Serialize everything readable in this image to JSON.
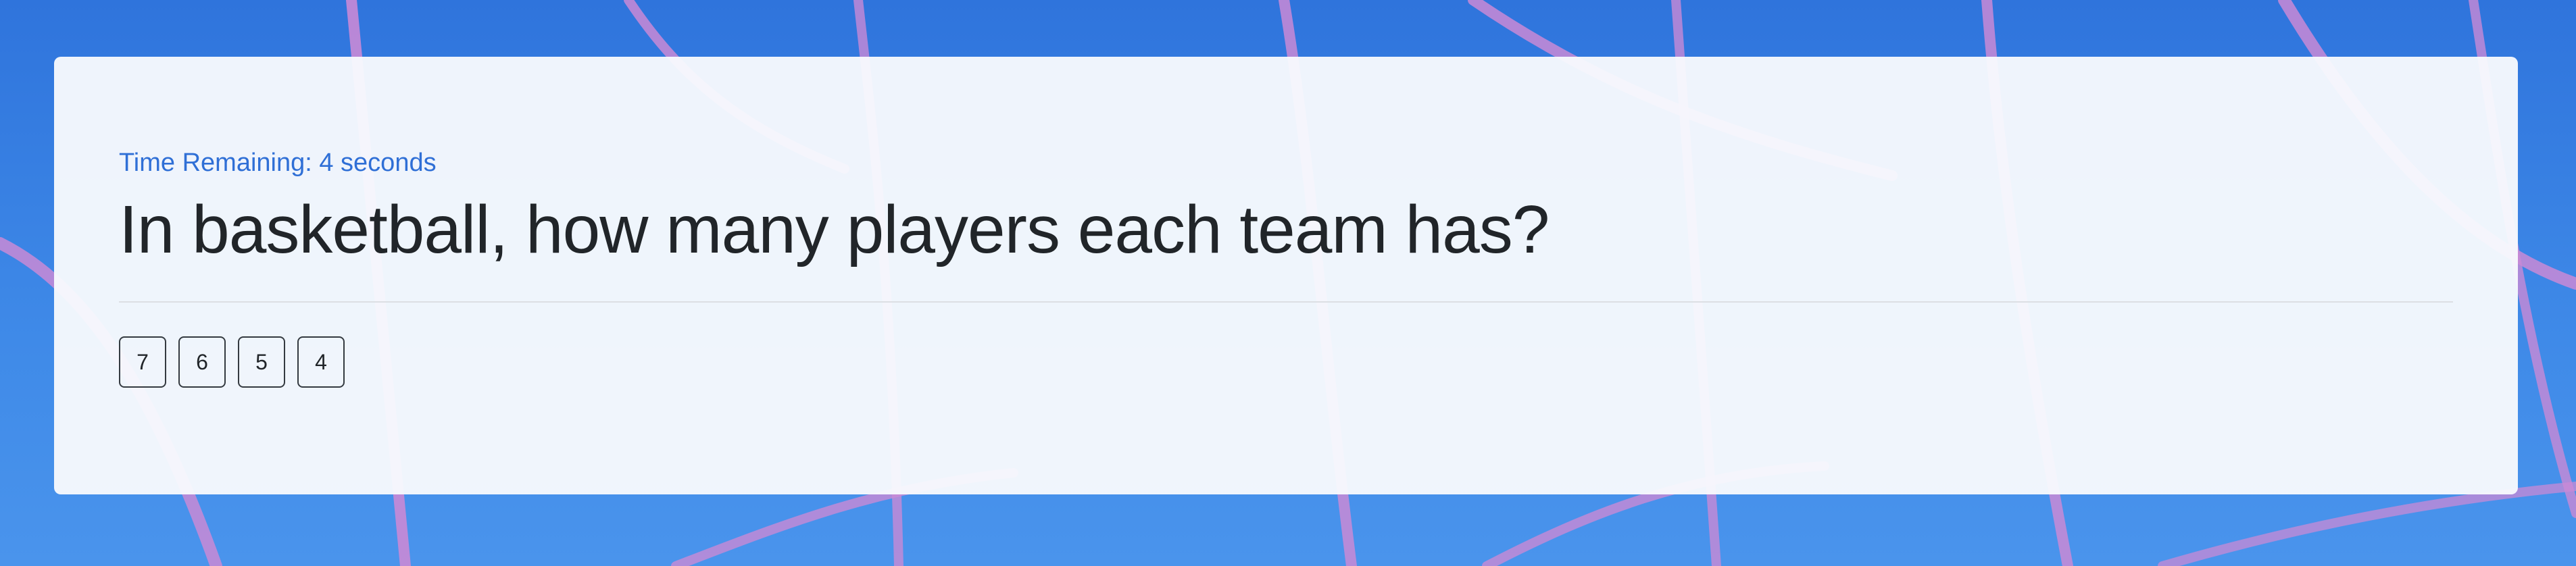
{
  "theme": {
    "background_blue": "#3a82e4",
    "net_color": "#c98ad6",
    "card_background": "#f8fafd",
    "timer_color": "#2f6fd6",
    "text_color": "#212529"
  },
  "quiz": {
    "timer_text": "Time Remaining: 4 seconds",
    "question": "In basketball, how many players each team has?",
    "answers": [
      "7",
      "6",
      "5",
      "4"
    ]
  }
}
